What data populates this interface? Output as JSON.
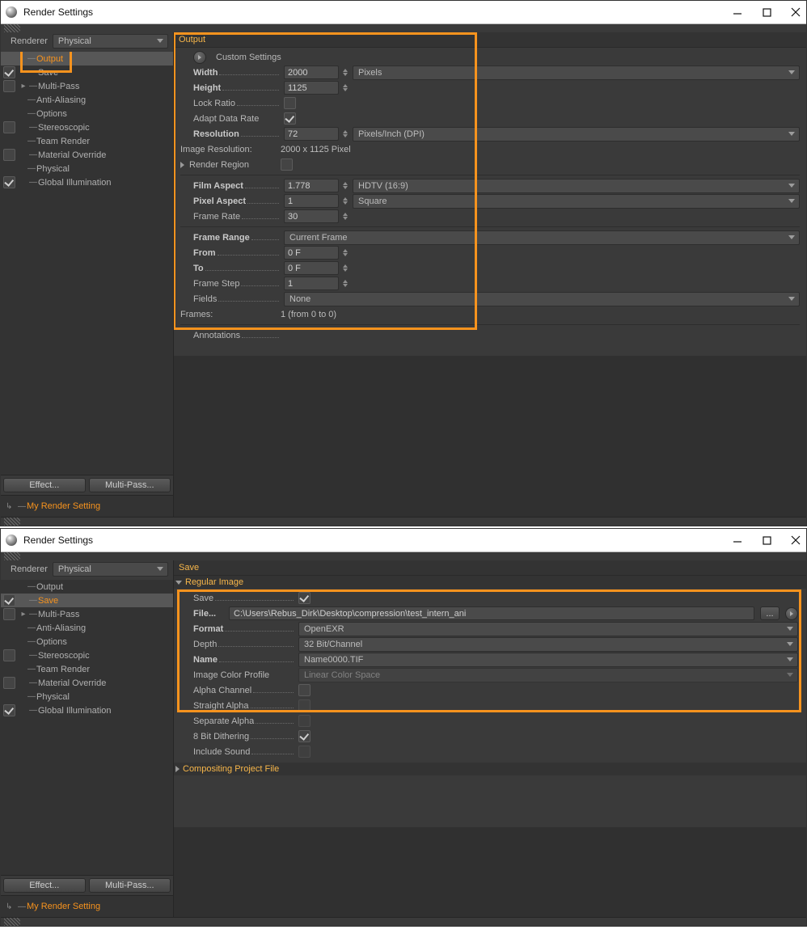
{
  "window": {
    "title": "Render Settings"
  },
  "top": {
    "renderer_label": "Renderer",
    "renderer_value": "Physical",
    "sidebar_items": [
      {
        "label": "Output",
        "checked": null,
        "selected": true,
        "orange": true,
        "arrow": false
      },
      {
        "label": "Save",
        "checked": true,
        "arrow": false
      },
      {
        "label": "Multi-Pass",
        "checked": false,
        "arrow": true
      },
      {
        "label": "Anti-Aliasing",
        "checked": null,
        "arrow": false
      },
      {
        "label": "Options",
        "checked": null,
        "arrow": false
      },
      {
        "label": "Stereoscopic",
        "checked": false,
        "arrow": false
      },
      {
        "label": "Team Render",
        "checked": null,
        "arrow": false
      },
      {
        "label": "Material Override",
        "checked": false,
        "arrow": false
      },
      {
        "label": "Physical",
        "checked": null,
        "arrow": false
      },
      {
        "label": "Global Illumination",
        "checked": true,
        "arrow": false
      }
    ],
    "effect_btn": "Effect...",
    "multipass_btn": "Multi-Pass...",
    "my_setting": "My Render Setting",
    "panel_title": "Output",
    "custom_settings": "Custom Settings",
    "width_label": "Width",
    "width_val": "2000",
    "width_unit": "Pixels",
    "height_label": "Height",
    "height_val": "1125",
    "lock_ratio": "Lock Ratio",
    "lock_ratio_on": false,
    "adapt": "Adapt Data Rate",
    "adapt_on": true,
    "resolution": "Resolution",
    "resolution_val": "72",
    "resolution_unit": "Pixels/Inch (DPI)",
    "img_res_label": "Image Resolution:",
    "img_res_val": "2000 x 1125 Pixel",
    "render_region": "Render Region",
    "render_region_on": false,
    "film_aspect": "Film Aspect",
    "film_aspect_val": "1.778",
    "film_aspect_preset": "HDTV (16:9)",
    "pixel_aspect": "Pixel Aspect",
    "pixel_aspect_val": "1",
    "pixel_aspect_preset": "Square",
    "frame_rate": "Frame Rate",
    "frame_rate_val": "30",
    "frame_range": "Frame Range",
    "frame_range_val": "Current Frame",
    "from": "From",
    "from_val": "0 F",
    "to": "To",
    "to_val": "0 F",
    "frame_step": "Frame Step",
    "frame_step_val": "1",
    "fields": "Fields",
    "fields_val": "None",
    "frames_label": "Frames:",
    "frames_val": "1 (from 0 to 0)",
    "annotations": "Annotations"
  },
  "bottom": {
    "renderer_label": "Renderer",
    "renderer_value": "Physical",
    "sidebar_items": [
      {
        "label": "Output",
        "checked": null
      },
      {
        "label": "Save",
        "checked": true,
        "orange": true,
        "selected": true
      },
      {
        "label": "Multi-Pass",
        "checked": false,
        "arrow": true
      },
      {
        "label": "Anti-Aliasing",
        "checked": null
      },
      {
        "label": "Options",
        "checked": null
      },
      {
        "label": "Stereoscopic",
        "checked": false
      },
      {
        "label": "Team Render",
        "checked": null
      },
      {
        "label": "Material Override",
        "checked": false
      },
      {
        "label": "Physical",
        "checked": null
      },
      {
        "label": "Global Illumination",
        "checked": true
      }
    ],
    "effect_btn": "Effect...",
    "multipass_btn": "Multi-Pass...",
    "my_setting": "My Render Setting",
    "panel_title": "Save",
    "regular_image": "Regular Image",
    "save_label": "Save",
    "save_on": true,
    "file_label": "File...",
    "file_val": "C:\\Users\\Rebus_Dirk\\Desktop\\compression\\test_intern_ani",
    "file_browse": "...",
    "format": "Format",
    "format_val": "OpenEXR",
    "depth": "Depth",
    "depth_val": "32 Bit/Channel",
    "name": "Name",
    "name_val": "Name0000.TIF",
    "icp": "Image Color Profile",
    "icp_val": "Linear Color Space",
    "alpha": "Alpha Channel",
    "alpha_on": false,
    "straight": "Straight Alpha",
    "straight_on": false,
    "sepa": "Separate Alpha",
    "sepa_on": false,
    "dith": "8 Bit Dithering",
    "dith_on": true,
    "sound": "Include Sound",
    "sound_on": false,
    "cpf": "Compositing Project File"
  }
}
